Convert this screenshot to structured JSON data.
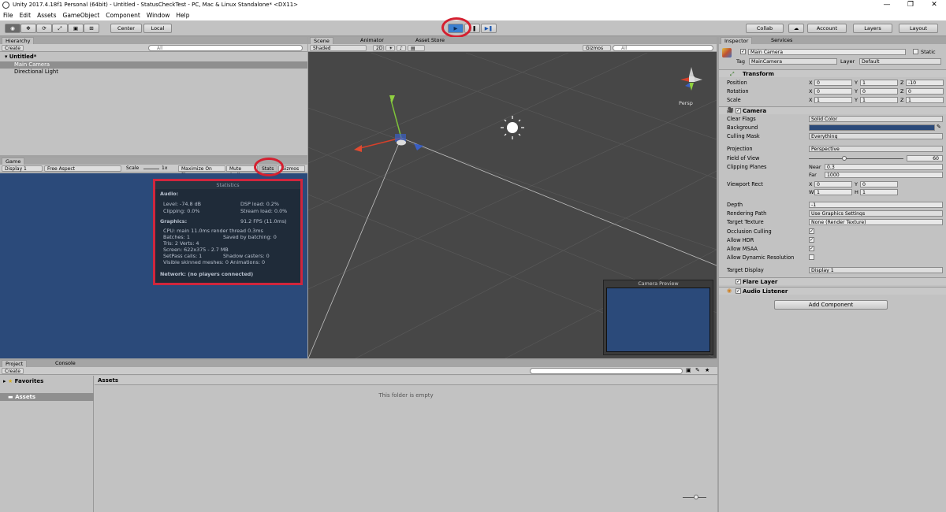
{
  "window": {
    "title": "Unity 2017.4.18f1 Personal (64bit) - Untitled - StatusCheckTest - PC, Mac & Linux Standalone* <DX11>",
    "min": "—",
    "max": "❐",
    "close": "✕"
  },
  "menu": [
    "File",
    "Edit",
    "Assets",
    "GameObject",
    "Component",
    "Window",
    "Help"
  ],
  "toolbar": {
    "center": "Center",
    "local": "Local",
    "collab": "Collab",
    "account": "Account",
    "layers": "Layers",
    "layout": "Layout"
  },
  "hierarchy": {
    "tab": "Hierarchy",
    "create": "Create",
    "search": "All",
    "scene": "Untitled*",
    "items": [
      "Main Camera",
      "Directional Light"
    ]
  },
  "game": {
    "tab": "Game",
    "display": "Display 1",
    "aspect": "Free Aspect",
    "scale_label": "Scale",
    "scale_value": "1x",
    "maximize": "Maximize On Play",
    "mute": "Mute Audio",
    "stats": "Stats",
    "gizmos": "Gizmos"
  },
  "stats": {
    "header": "Statistics",
    "audio_title": "Audio:",
    "level": "Level: -74.8 dB",
    "clipping": "Clipping: 0.0%",
    "dsp": "DSP load: 0.2%",
    "stream": "Stream load: 0.0%",
    "graphics_title": "Graphics:",
    "fps": "91.2 FPS (11.0ms)",
    "cpu": "CPU: main 11.0ms  render thread 0.3ms",
    "batches": "Batches: 1",
    "saved": "Saved by batching: 0",
    "tris": "Tris: 2     Verts: 4",
    "screen": "Screen: 622x375 - 2.7 MB",
    "setpass": "SetPass calls: 1",
    "shadow": "Shadow casters: 0",
    "skinned": "Visible skinned meshes: 0  Animations: 0",
    "network": "Network: (no players connected)"
  },
  "scene": {
    "tabs": [
      "Scene",
      "Animator",
      "Asset Store"
    ],
    "shading": "Shaded",
    "mode2d": "2D",
    "gizmos": "Gizmos",
    "search": "All",
    "persp": "Persp",
    "camera_preview": "Camera Preview"
  },
  "inspector": {
    "tabs": [
      "Inspector",
      "Services"
    ],
    "name": "Main Camera",
    "static": "Static",
    "tag_label": "Tag",
    "tag": "MainCamera",
    "layer_label": "Layer",
    "layer": "Default",
    "transform": {
      "title": "Transform",
      "rows": [
        {
          "label": "Position",
          "x": "0",
          "y": "1",
          "z": "-10"
        },
        {
          "label": "Rotation",
          "x": "0",
          "y": "0",
          "z": "0"
        },
        {
          "label": "Scale",
          "x": "1",
          "y": "1",
          "z": "1"
        }
      ]
    },
    "camera": {
      "title": "Camera",
      "clear_flags_label": "Clear Flags",
      "clear_flags": "Solid Color",
      "background_label": "Background",
      "culling_label": "Culling Mask",
      "culling": "Everything",
      "projection_label": "Projection",
      "projection": "Perspective",
      "fov_label": "Field of View",
      "fov": "60",
      "clipping_label": "Clipping Planes",
      "near_label": "Near",
      "near": "0.3",
      "far_label": "Far",
      "far": "1000",
      "viewport_label": "Viewport Rect",
      "vx": "0",
      "vy": "0",
      "vw": "1",
      "vh": "1",
      "depth_label": "Depth",
      "depth": "-1",
      "rendering_label": "Rendering Path",
      "rendering": "Use Graphics Settings",
      "target_label": "Target Texture",
      "target": "None (Render Texture)",
      "occlusion": "Occlusion Culling",
      "hdr": "Allow HDR",
      "msaa": "Allow MSAA",
      "dynres": "Allow Dynamic Resolution",
      "display_label": "Target Display",
      "display": "Display 1"
    },
    "flare": "Flare Layer",
    "audio": "Audio Listener",
    "add_component": "Add Component",
    "bg_color": "#2b4a7a"
  },
  "project": {
    "tabs": [
      "Project",
      "Console"
    ],
    "create": "Create",
    "favorites": "Favorites",
    "assets": "Assets",
    "header": "Assets",
    "empty": "This folder is empty"
  }
}
